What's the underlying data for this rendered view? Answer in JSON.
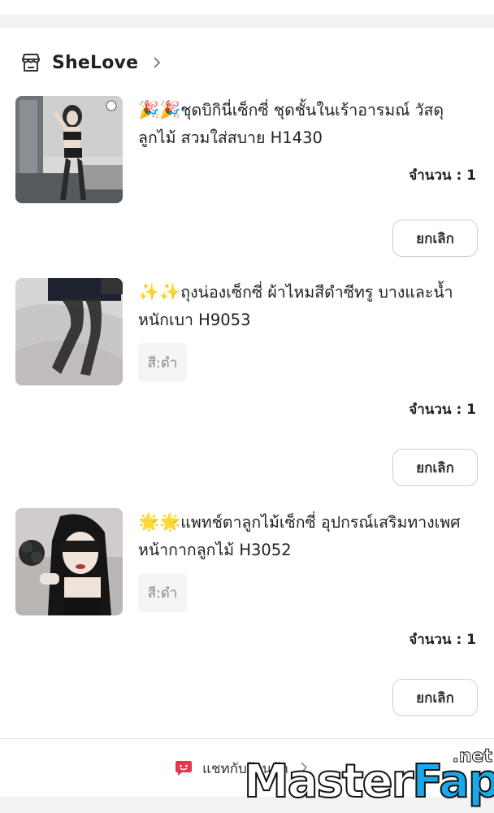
{
  "shop": {
    "name": "SheLove",
    "icon": "store-icon"
  },
  "items": [
    {
      "title_emoji": "🎉🎉",
      "title": "ชุดบิกินี่เซ็กซี่ ชุดชั้นในเร้าอารมณ์ วัสดุลูกไม้ สวมใส่สบาย H1430",
      "variant": "",
      "quantity": "จำนวน : 1",
      "cancel_label": "ยกเลิก"
    },
    {
      "title_emoji": "✨✨",
      "title": "ถุงน่องเซ็กซี่ ผ้าไหมสีดำซีทรู บางและน้ำหนักเบา  H9053",
      "variant": "สี:ดำ",
      "quantity": "จำนวน : 1",
      "cancel_label": "ยกเลิก"
    },
    {
      "title_emoji": "🌟🌟",
      "title": "แพทช์ตาลูกไม้เซ็กซี่ อุปกรณ์เสริมทางเพศ หน้ากากลูกไม้ H3052",
      "variant": "สี:ดำ",
      "quantity": "จำนวน : 1",
      "cancel_label": "ยกเลิก"
    }
  ],
  "footer": {
    "chat_label": "แชทกับร้านค้า",
    "chat_icon": "chat-bubble-icon",
    "chevron_icon": "chevron-right-icon"
  },
  "watermark": {
    "text_a": "Master",
    "text_b": "Fap",
    "suffix": ".net"
  },
  "colors": {
    "accent_chat": "#e8344e",
    "watermark_blue": "#1aa8e8"
  }
}
